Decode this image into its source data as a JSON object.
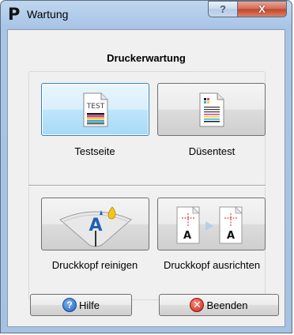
{
  "window": {
    "title": "Wartung",
    "app_icon_letter": "P",
    "help_glyph": "?",
    "close_glyph": "X"
  },
  "panel": {
    "heading": "Druckerwartung"
  },
  "actions": {
    "nozzle_check_print": {
      "label": "Testseite",
      "icon_text": "TEST"
    },
    "nozzle_test": {
      "label": "Düsentest"
    },
    "head_cleaning": {
      "label": "Druckkopf reinigen",
      "icon_letter": "A"
    },
    "head_alignment": {
      "label": "Druckkopf ausrichten",
      "icon_letter_left": "A",
      "icon_letter_right": "A"
    }
  },
  "footer": {
    "help_label": "Hilfe",
    "help_glyph": "?",
    "exit_label": "Beenden",
    "exit_glyph": "✕"
  },
  "colors": {
    "accent": "#3c7fb1",
    "titlebar": "#a8c4e6",
    "close_button": "#c1442a",
    "help_icon": "#1f5fb8",
    "exit_icon": "#c8231a"
  }
}
